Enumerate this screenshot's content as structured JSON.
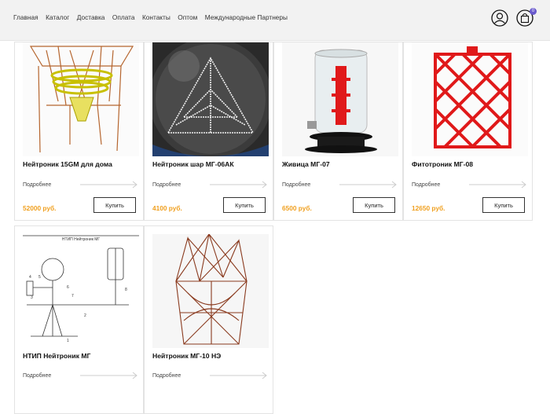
{
  "nav": {
    "items": [
      "Главная",
      "Каталог",
      "Доставка",
      "Оплата",
      "Контакты",
      "Оптом",
      "Международные Партнеры"
    ]
  },
  "header": {
    "user_icon": "user-icon",
    "cart_icon": "shopping-bag-icon",
    "cart_count": "0",
    "badge_color": "#6a5acd"
  },
  "colors": {
    "price": "#f0a020",
    "copper": "#b5652e",
    "red": "#e0191a"
  },
  "products": [
    {
      "title": "Нейтроник 15GM для дома",
      "more": "Подробнее",
      "price": "52000 руб.",
      "buy": "Купить"
    },
    {
      "title": "Нейтроник шар МГ-06АК",
      "more": "Подробнее",
      "price": "4100 руб.",
      "buy": "Купить"
    },
    {
      "title": "Живица МГ-07",
      "more": "Подробнее",
      "price": "6500 руб.",
      "buy": "Купить"
    },
    {
      "title": "Фитотроник МГ-08",
      "more": "Подробнее",
      "price": "12650 руб.",
      "buy": "Купить"
    },
    {
      "title": "НТИП Нейтроник МГ",
      "more": "Подробнее",
      "price": "",
      "buy": "",
      "image_caption": "НТИП Нейтроник МГ",
      "diagram_labels": [
        "1",
        "2",
        "3",
        "4",
        "5",
        "6",
        "7",
        "8"
      ]
    },
    {
      "title": "Нейтроник МГ-10 НЭ",
      "more": "Подробнее",
      "price": "",
      "buy": ""
    }
  ]
}
